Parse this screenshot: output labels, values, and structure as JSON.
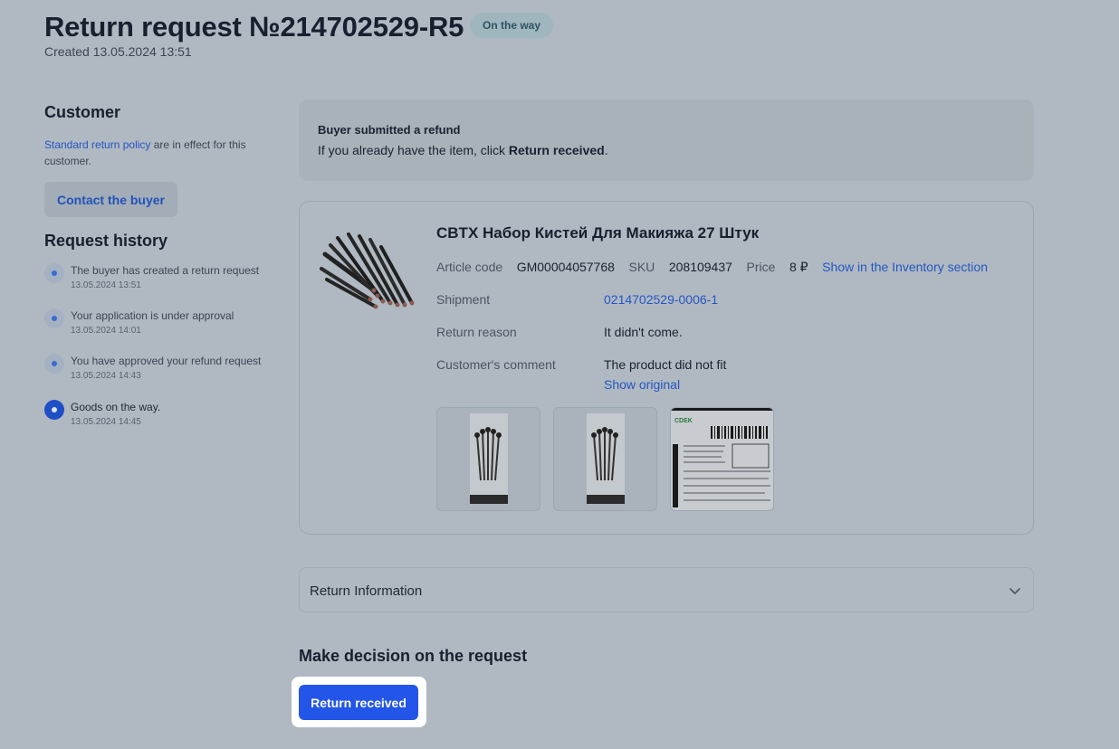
{
  "header": {
    "title": "Return request №214702529-R5",
    "status": "On the way",
    "created": "Created 13.05.2024 13:51"
  },
  "customer": {
    "title": "Customer",
    "policy_link": "Standard return policy",
    "policy_text": " are in effect for this customer.",
    "contact_label": "Contact the buyer"
  },
  "history": {
    "title": "Request history",
    "items": [
      {
        "text": "The buyer has created a return request",
        "date": "13.05.2024 13:51"
      },
      {
        "text": "Your application is under approval",
        "date": "13.05.2024 14:01"
      },
      {
        "text": "You have approved your refund request",
        "date": "13.05.2024 14:43"
      },
      {
        "text": "Goods on the way.",
        "date": "13.05.2024 14:45"
      }
    ]
  },
  "notice": {
    "title": "Buyer submitted a refund",
    "text_before": "If you already have the item, click ",
    "text_bold": "Return received",
    "text_after": "."
  },
  "product": {
    "title": "CBTX Набор Кистей Для Макияжа 27 Штук",
    "article_label": "Article code",
    "article_value": "GM00004057768",
    "sku_label": "SKU",
    "sku_value": "208109437",
    "price_label": "Price",
    "price_value": "8 ₽",
    "inventory_link": "Show in the Inventory section",
    "shipment_label": "Shipment",
    "shipment_value": "0214702529-0006-1",
    "reason_label": "Return reason",
    "reason_value": "It didn't come.",
    "comment_label": "Customer's comment",
    "comment_value": "The product did not fit",
    "show_original": "Show original",
    "label_brand": "CDEK"
  },
  "accordion": {
    "label": "Return Information"
  },
  "decision": {
    "title": "Make decision on the request",
    "button_label": "Return received"
  }
}
